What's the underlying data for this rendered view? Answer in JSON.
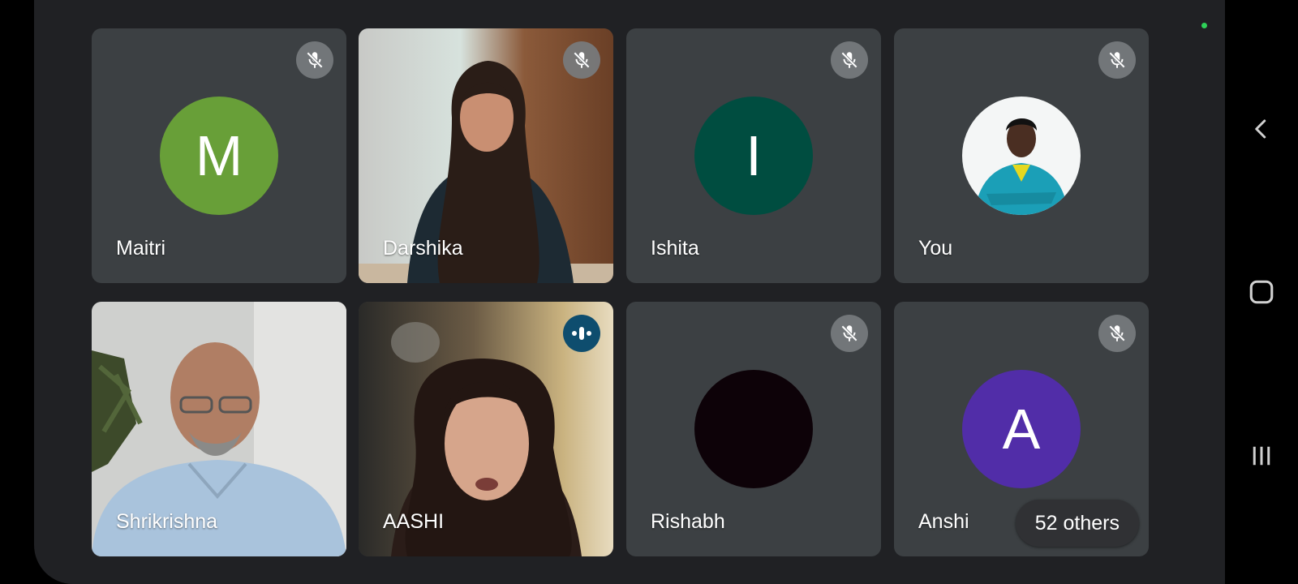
{
  "participants": [
    {
      "name": "Maitri",
      "initial": "M",
      "avatar_color": "#689f38",
      "muted": true
    },
    {
      "name": "Darshika",
      "muted": true
    },
    {
      "name": "Ishita",
      "initial": "I",
      "avatar_color": "#004d40",
      "muted": true
    },
    {
      "name": "You",
      "muted": true
    },
    {
      "name": "Shrikrishna",
      "muted": false
    },
    {
      "name": "AASHI",
      "muted": false,
      "speaking": true
    },
    {
      "name": "Rishabh",
      "avatar_color": "#0d0208",
      "muted": true
    },
    {
      "name": "Anshi",
      "initial": "A",
      "avatar_color": "#512da8",
      "muted": true
    }
  ],
  "others_label": "52 others",
  "icons": {
    "mute": "mic-off-icon",
    "speaking": "audio-wave-icon",
    "nav_back": "chevron-left-icon",
    "nav_home": "home-square-icon",
    "nav_recents": "recents-icon"
  },
  "colors": {
    "background": "#202124",
    "tile": "#3c4043",
    "speaking_badge": "#0e4d6e",
    "status_dot": "#2ed158"
  }
}
